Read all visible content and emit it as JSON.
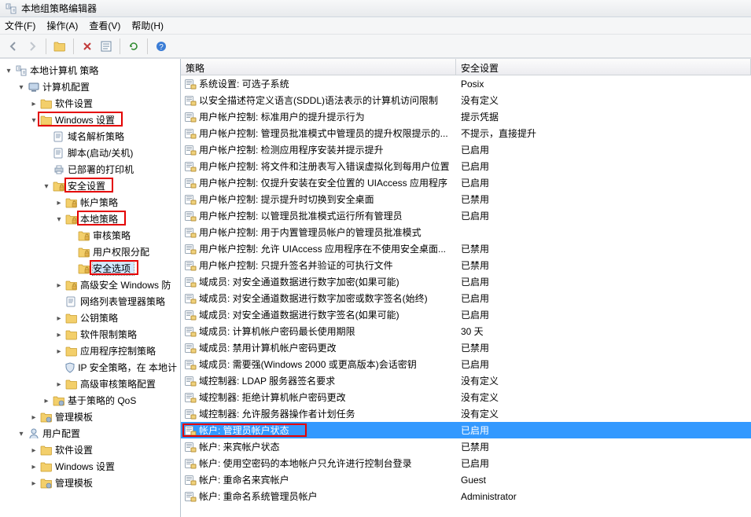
{
  "window": {
    "title": "本地组策略编辑器"
  },
  "menus": {
    "file": "文件(F)",
    "action": "操作(A)",
    "view": "查看(V)",
    "help": "帮助(H)"
  },
  "tree": {
    "root": "本地计算机 策略",
    "computer_config": "计算机配置",
    "software_settings": "软件设置",
    "windows_settings": "Windows 设置",
    "dns_policy": "域名解析策略",
    "scripts": "脚本(启动/关机)",
    "deployed_printers": "已部署的打印机",
    "security_settings": "安全设置",
    "account_policy": "帐户策略",
    "local_policy": "本地策略",
    "audit_policy": "审核策略",
    "user_rights": "用户权限分配",
    "security_options": "安全选项",
    "advanced_windows_fw": "高级安全 Windows 防",
    "network_list_mgr": "网络列表管理器策略",
    "public_key": "公钥策略",
    "software_restriction": "软件限制策略",
    "app_control": "应用程序控制策略",
    "ip_security": "IP 安全策略，在 本地计",
    "advanced_audit": "高级审核策略配置",
    "qos": "基于策略的 QoS",
    "admin_templates_c": "管理模板",
    "user_config": "用户配置",
    "user_software": "软件设置",
    "user_windows": "Windows 设置",
    "user_admin_templates": "管理模板"
  },
  "list": {
    "header_policy": "策略",
    "header_setting": "安全设置",
    "rows": [
      {
        "name": "系统设置: 可选子系统",
        "value": "Posix"
      },
      {
        "name": "以安全描述符定义语言(SDDL)语法表示的计算机访问限制",
        "value": "没有定义"
      },
      {
        "name": "用户帐户控制: 标准用户的提升提示行为",
        "value": "提示凭据"
      },
      {
        "name": "用户帐户控制: 管理员批准模式中管理员的提升权限提示的...",
        "value": "不提示，直接提升"
      },
      {
        "name": "用户帐户控制: 检测应用程序安装并提示提升",
        "value": "已启用"
      },
      {
        "name": "用户帐户控制: 将文件和注册表写入错误虚拟化到每用户位置",
        "value": "已启用"
      },
      {
        "name": "用户帐户控制: 仅提升安装在安全位置的 UIAccess 应用程序",
        "value": "已启用"
      },
      {
        "name": "用户帐户控制: 提示提升时切换到安全桌面",
        "value": "已禁用"
      },
      {
        "name": "用户帐户控制: 以管理员批准模式运行所有管理员",
        "value": "已启用"
      },
      {
        "name": "用户帐户控制: 用于内置管理员帐户的管理员批准模式",
        "value": ""
      },
      {
        "name": "用户帐户控制: 允许 UIAccess 应用程序在不使用安全桌面...",
        "value": "已禁用"
      },
      {
        "name": "用户帐户控制: 只提升签名并验证的可执行文件",
        "value": "已禁用"
      },
      {
        "name": "域成员: 对安全通道数据进行数字加密(如果可能)",
        "value": "已启用"
      },
      {
        "name": "域成员: 对安全通道数据进行数字加密或数字签名(始终)",
        "value": "已启用"
      },
      {
        "name": "域成员: 对安全通道数据进行数字签名(如果可能)",
        "value": "已启用"
      },
      {
        "name": "域成员: 计算机帐户密码最长使用期限",
        "value": "30 天"
      },
      {
        "name": "域成员: 禁用计算机帐户密码更改",
        "value": "已禁用"
      },
      {
        "name": "域成员: 需要强(Windows 2000 或更高版本)会话密钥",
        "value": "已启用"
      },
      {
        "name": "域控制器: LDAP 服务器签名要求",
        "value": "没有定义"
      },
      {
        "name": "域控制器: 拒绝计算机帐户密码更改",
        "value": "没有定义"
      },
      {
        "name": "域控制器: 允许服务器操作者计划任务",
        "value": "没有定义"
      },
      {
        "name": "帐户: 管理员帐户状态",
        "value": "已启用",
        "selected": true
      },
      {
        "name": "帐户: 来宾帐户状态",
        "value": "已禁用"
      },
      {
        "name": "帐户: 使用空密码的本地帐户只允许进行控制台登录",
        "value": "已启用"
      },
      {
        "name": "帐户: 重命名来宾帐户",
        "value": "Guest"
      },
      {
        "name": "帐户: 重命名系统管理员帐户",
        "value": "Administrator"
      }
    ]
  }
}
